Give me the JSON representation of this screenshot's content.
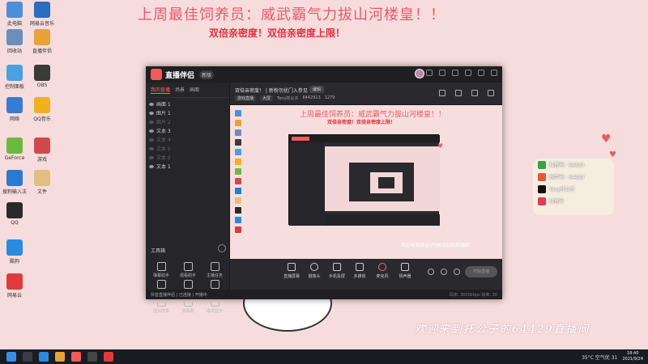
{
  "desktop": {
    "headline": "上周最佳饲养员：威武霸气力拔山河楼皇！！",
    "subline": "双倍亲密度！双倍亲密度上限！",
    "welcome": "欢迎来到托公子的64429直播间",
    "icons": [
      {
        "label": "此电脑",
        "color": "#4a90d9"
      },
      {
        "label": "网易云音乐",
        "color": "#2b6bc0"
      },
      {
        "label": "回收站",
        "color": "#6a8fbf"
      },
      {
        "label": "直播伴侣",
        "color": "#e8a23a"
      },
      {
        "label": "控制面板",
        "color": "#4aa0e0"
      },
      {
        "label": "OBS",
        "color": "#3a3a3a"
      },
      {
        "label": "网络",
        "color": "#3a7ad0"
      },
      {
        "label": "QQ音乐",
        "color": "#f0b020"
      },
      {
        "label": "GeForce",
        "color": "#6cba3c"
      },
      {
        "label": "游戏",
        "color": "#d04a4a"
      },
      {
        "label": "搜狗输入法",
        "color": "#2a7ad0"
      },
      {
        "label": "文件",
        "color": "#e0c080"
      },
      {
        "label": "QQ",
        "color": "#2a2a2a"
      },
      {
        "label": "酷狗",
        "color": "#2a8ae0"
      },
      {
        "label": "网易云",
        "color": "#e03a3a"
      }
    ],
    "social": [
      {
        "label": "抖音号：64429",
        "color": "#3aa24a"
      },
      {
        "label": "快手号：64429",
        "color": "#e05a3a"
      },
      {
        "label": "Tony托公子",
        "color": "#111111"
      },
      {
        "label": "抖音号",
        "color": "#e03a5a"
      }
    ]
  },
  "app": {
    "title": "直播伴侣",
    "version": "新版",
    "left_tabs": [
      "我的直播",
      "场景",
      "画面"
    ],
    "scenes": [
      {
        "label": "画面 1",
        "visible": true
      },
      {
        "label": "图片 1",
        "visible": true
      },
      {
        "label": "图片 2",
        "visible": false
      },
      {
        "label": "文本 3",
        "visible": true
      },
      {
        "label": "文本 4",
        "visible": false
      },
      {
        "label": "文本 5",
        "visible": false
      },
      {
        "label": "文本 2",
        "visible": false
      },
      {
        "label": "文本 1",
        "visible": true
      }
    ],
    "tools_title": "工具箱",
    "tools": [
      "弹幕助手",
      "观看助手",
      "主播任务",
      "视频连麦",
      "多人连麦",
      "连线PK",
      "虚拟形象",
      "弹幕屏",
      "歌词显示"
    ],
    "room_title": "双倍亲密度！ | 新粉勿扰门入参见",
    "room_edit": "编辑",
    "room_meta": [
      "游戏直播",
      "大屏",
      "Tony托公子",
      "6442913",
      "1279"
    ],
    "preview": {
      "headline": "上周最佳饲养员：威武霸气力拔山河楼皇！！",
      "subline": "双倍亲密度！双倍亲密度上限！",
      "watermark": "欢迎来到托公子的64429直播间"
    },
    "controls": [
      "直播屏幕",
      "摄像头",
      "手机投屏",
      "多媒体",
      "麦克风",
      "扬声器"
    ],
    "start_button": "开始直播",
    "status": "抖音直播伴侣 | 已连接 | 开播中",
    "status_right": "码率: 3000kbps 帧率: 30"
  },
  "taskbar": {
    "weather": "35°C 空气优 31",
    "time": "18:40",
    "date": "2021/9/24"
  }
}
